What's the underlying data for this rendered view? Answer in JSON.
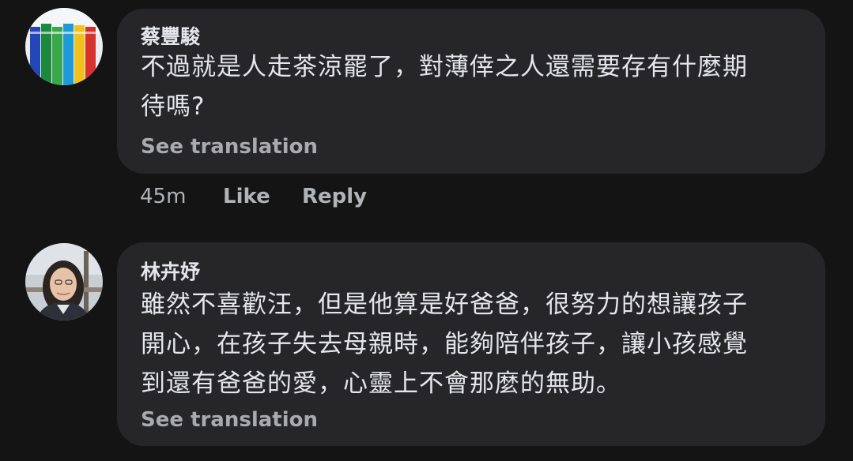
{
  "comments": [
    {
      "author": "蔡豐駿",
      "text_lines": [
        "不過就是人走茶涼罷了，對薄倖之人還需要存有什麼期",
        "待嗎?"
      ],
      "see_translation": "See translation",
      "time": "45m",
      "like_label": "Like",
      "reply_label": "Reply",
      "avatar_icon": "colored-pencils-avatar"
    },
    {
      "author": "林卉妤",
      "text_lines": [
        "雖然不喜歡汪，但是他算是好爸爸，很努力的想讓孩子",
        "開心，在孩子失去母親時，能夠陪伴孩子，讓小孩感覺",
        "到還有爸爸的愛，心靈上不會那麼的無助。"
      ],
      "see_translation": "See translation",
      "avatar_icon": "woman-portrait-avatar"
    }
  ],
  "colors": {
    "background": "#141414",
    "bubble": "#262628",
    "text": "#e4e6eb",
    "secondary_text": "#b0b3b8"
  }
}
